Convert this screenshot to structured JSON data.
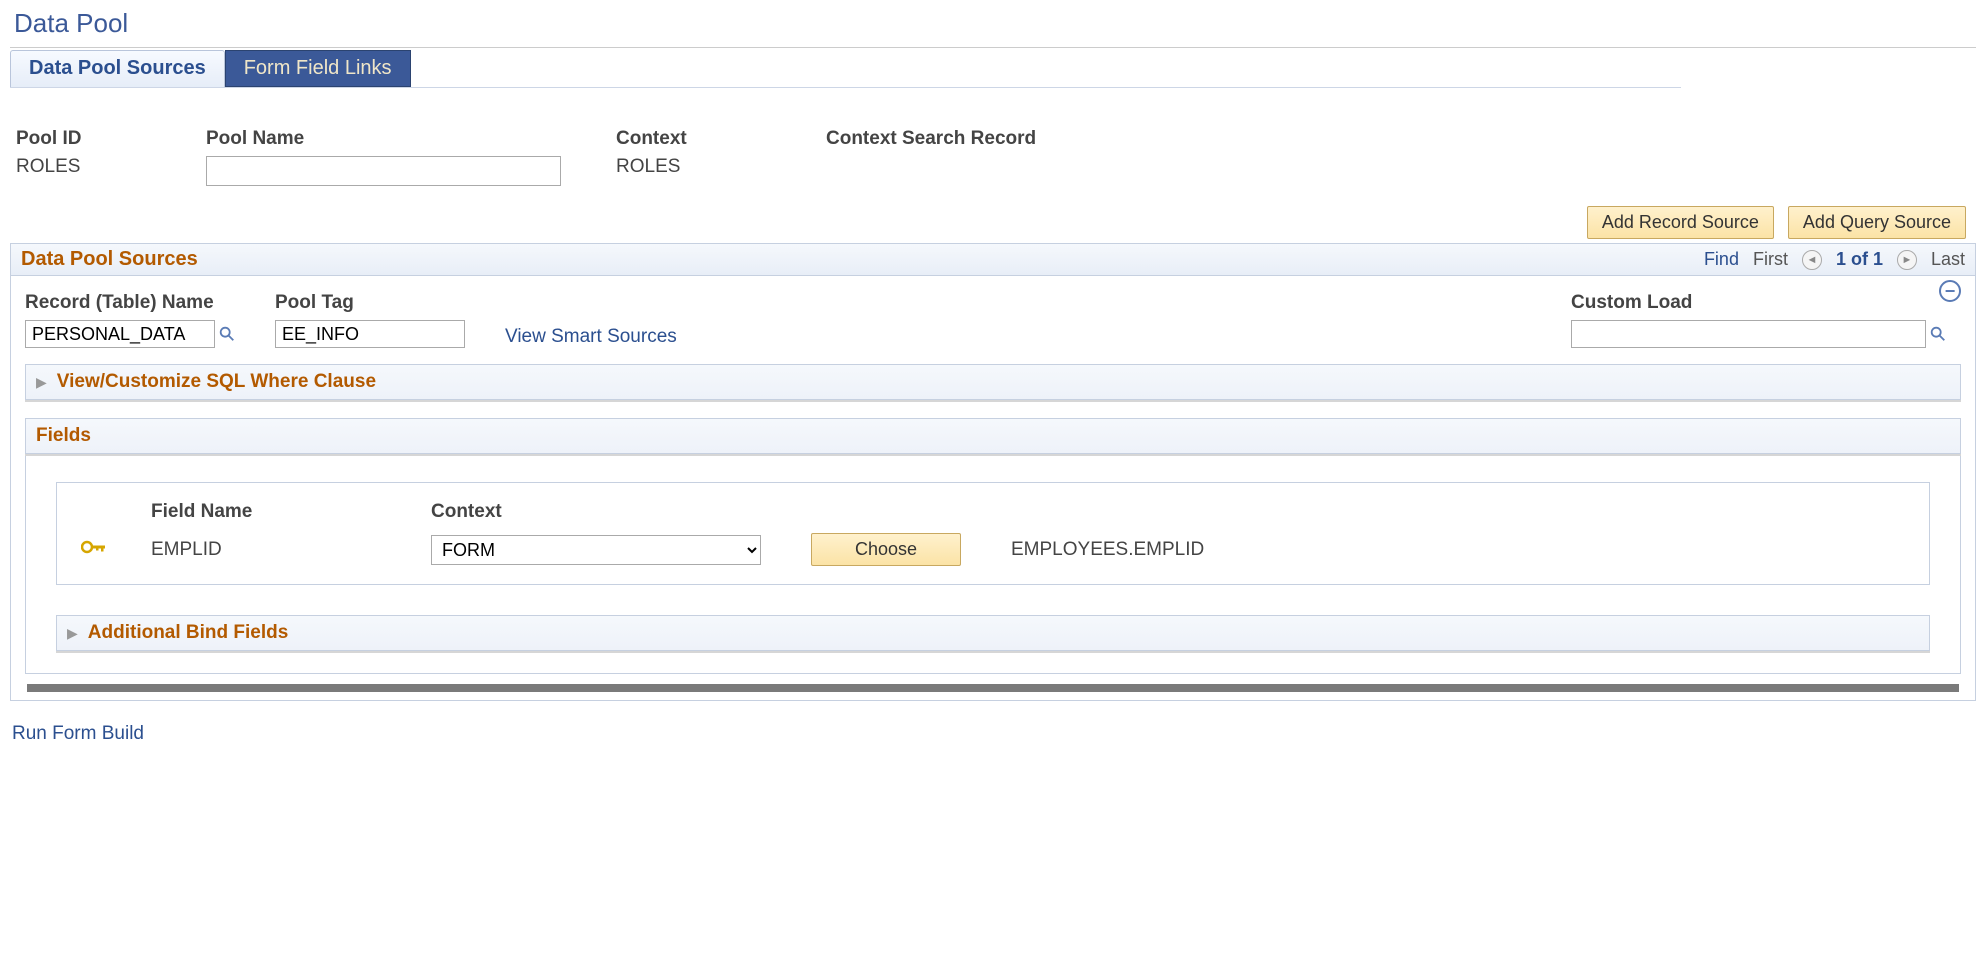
{
  "page": {
    "title": "Data Pool"
  },
  "tabs": {
    "active": "Data Pool Sources",
    "inactive": "Form Field Links"
  },
  "header": {
    "pool_id_label": "Pool ID",
    "pool_id_value": "ROLES",
    "pool_name_label": "Pool Name",
    "pool_name_value": "",
    "context_label": "Context",
    "context_value": "ROLES",
    "csr_label": "Context Search Record"
  },
  "buttons": {
    "add_record": "Add Record Source",
    "add_query": "Add Query Source",
    "choose": "Choose"
  },
  "grid": {
    "title": "Data Pool Sources",
    "find": "Find",
    "first": "First",
    "position": "1 of 1",
    "last": "Last"
  },
  "source": {
    "record_label": "Record (Table) Name",
    "record_value": "PERSONAL_DATA",
    "tag_label": "Pool Tag",
    "tag_value": "EE_INFO",
    "smart_link": "View Smart Sources",
    "custom_label": "Custom Load",
    "custom_value": ""
  },
  "sections": {
    "sql": "View/Customize SQL Where Clause",
    "fields": "Fields",
    "bind": "Additional Bind Fields"
  },
  "field": {
    "name_label": "Field Name",
    "name_value": "EMPLID",
    "context_label": "Context",
    "context_value": "FORM",
    "mapping": "EMPLOYEES.EMPLID"
  },
  "footer": {
    "run": "Run Form Build"
  }
}
